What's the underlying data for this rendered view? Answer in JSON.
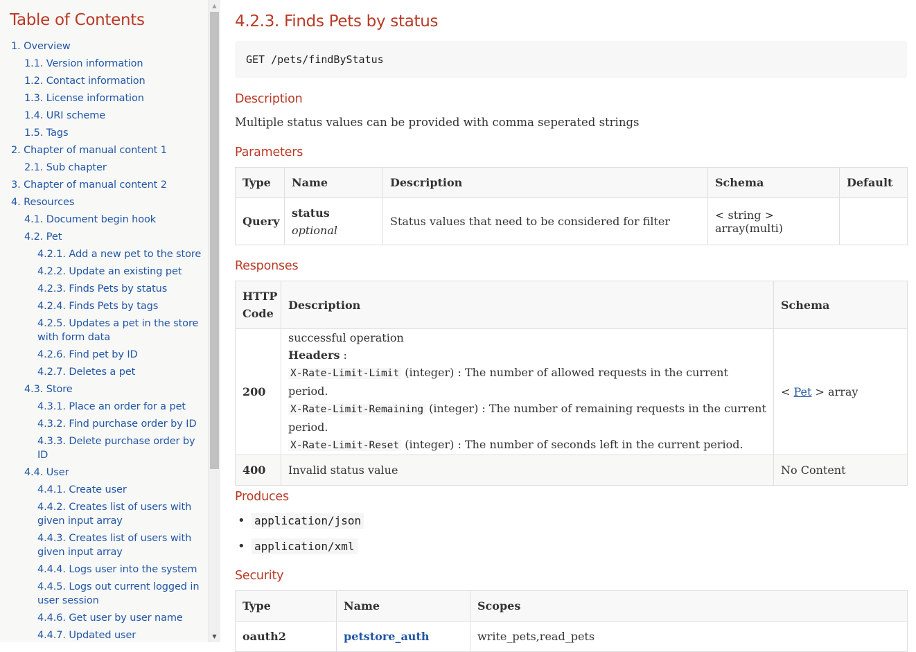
{
  "toc": {
    "title": "Table of Contents",
    "items": [
      {
        "label": "1. Overview",
        "level": 1
      },
      {
        "label": "1.1. Version information",
        "level": 2
      },
      {
        "label": "1.2. Contact information",
        "level": 2
      },
      {
        "label": "1.3. License information",
        "level": 2
      },
      {
        "label": "1.4. URI scheme",
        "level": 2
      },
      {
        "label": "1.5. Tags",
        "level": 2
      },
      {
        "label": "2. Chapter of manual content 1",
        "level": 1
      },
      {
        "label": "2.1. Sub chapter",
        "level": 2
      },
      {
        "label": "3. Chapter of manual content 2",
        "level": 1
      },
      {
        "label": "4. Resources",
        "level": 1
      },
      {
        "label": "4.1. Document begin hook",
        "level": 2
      },
      {
        "label": "4.2. Pet",
        "level": 2
      },
      {
        "label": "4.2.1. Add a new pet to the store",
        "level": 3
      },
      {
        "label": "4.2.2. Update an existing pet",
        "level": 3
      },
      {
        "label": "4.2.3. Finds Pets by status",
        "level": 3
      },
      {
        "label": "4.2.4. Finds Pets by tags",
        "level": 3
      },
      {
        "label": "4.2.5. Updates a pet in the store",
        "label2": "with form data",
        "level": 3
      },
      {
        "label": "4.2.6. Find pet by ID",
        "level": 3
      },
      {
        "label": "4.2.7. Deletes a pet",
        "level": 3
      },
      {
        "label": "4.3. Store",
        "level": 2
      },
      {
        "label": "4.3.1. Place an order for a pet",
        "level": 3
      },
      {
        "label": "4.3.2. Find purchase order by ID",
        "level": 3
      },
      {
        "label": "4.3.3. Delete purchase order by",
        "label2": "ID",
        "level": 3
      },
      {
        "label": "4.4. User",
        "level": 2
      },
      {
        "label": "4.4.1. Create user",
        "level": 3
      },
      {
        "label": "4.4.2. Creates list of users with",
        "label2": "given input array",
        "level": 3
      },
      {
        "label": "4.4.3. Creates list of users with",
        "label2": "given input array",
        "level": 3
      },
      {
        "label": "4.4.4. Logs user into the system",
        "level": 3
      },
      {
        "label": "4.4.5. Logs out current logged in",
        "label2": "user session",
        "level": 3
      },
      {
        "label": "4.4.6. Get user by user name",
        "level": 3
      },
      {
        "label": "4.4.7. Updated user",
        "level": 3
      }
    ]
  },
  "operation": {
    "title": "4.2.3. Finds Pets by status",
    "endpoint": "GET /pets/findByStatus"
  },
  "description": {
    "heading": "Description",
    "text": "Multiple status values can be provided with comma seperated strings"
  },
  "parameters": {
    "heading": "Parameters",
    "headers": [
      "Type",
      "Name",
      "Description",
      "Schema",
      "Default"
    ],
    "row": {
      "type": "Query",
      "name": "status",
      "modifier": "optional",
      "description": "Status values that need to be considered for filter",
      "schema": "< string > array(multi)",
      "default": ""
    }
  },
  "responses": {
    "heading": "Responses",
    "headers": {
      "code1": "HTTP",
      "code2": "Code",
      "description": "Description",
      "schema": "Schema"
    },
    "r200": {
      "code": "200",
      "text": "successful operation",
      "headers_label": "Headers",
      "colon": " :",
      "h1_name": "X-Rate-Limit-Limit",
      "h1_desc": " (integer) : The number of allowed requests in the current period.",
      "h2_name": "X-Rate-Limit-Remaining",
      "h2_desc": " (integer) : The number of remaining requests in the current",
      "h2_desc2": "period.",
      "h3_name": "X-Rate-Limit-Reset",
      "h3_desc": " (integer) : The number of seconds left in the current period.",
      "schema_pre": "< ",
      "schema_link": "Pet",
      "schema_post": " > array"
    },
    "r400": {
      "code": "400",
      "text": "Invalid status value",
      "schema": "No Content"
    }
  },
  "produces": {
    "heading": "Produces",
    "items": [
      "application/json",
      "application/xml"
    ]
  },
  "security": {
    "heading": "Security",
    "headers": [
      "Type",
      "Name",
      "Scopes"
    ],
    "row": {
      "type": "oauth2",
      "name": "petstore_auth",
      "scopes": "write_pets,read_pets"
    }
  }
}
